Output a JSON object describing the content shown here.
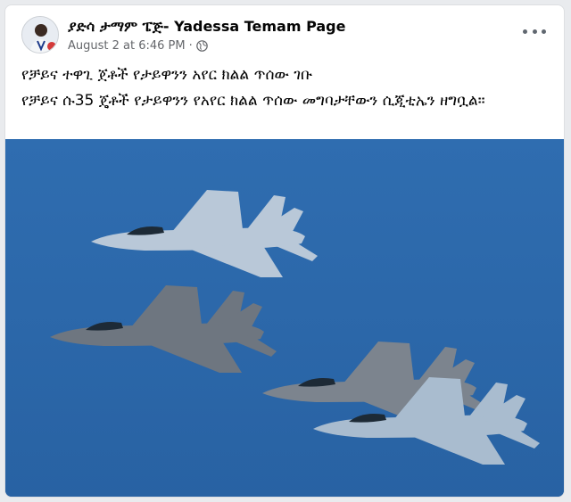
{
  "post": {
    "page_name": "ያድሳ ታማም ፔጅ- Yadessa Temam Page",
    "timestamp": "August 2 at 6:46 PM",
    "separator": "·",
    "privacy_icon": "globe-icon",
    "more_icon": "more-options-icon",
    "text_line_1": "የቻይና ተዋጊ ጀቶች የታይዋንን አየር ክልል ጥሰው ገቡ",
    "text_line_2": "የቻይና ሱ35 ጄቶች የታይዋንን የአየር ክልል ጥሰው መግባታቸውን ሲጂቲኤን ዘግቧል።"
  },
  "colors": {
    "sky": "#2a68a8",
    "jet_light": "#b9c8d8",
    "jet_dark": "#6e7680",
    "meta_text": "#65676b"
  }
}
